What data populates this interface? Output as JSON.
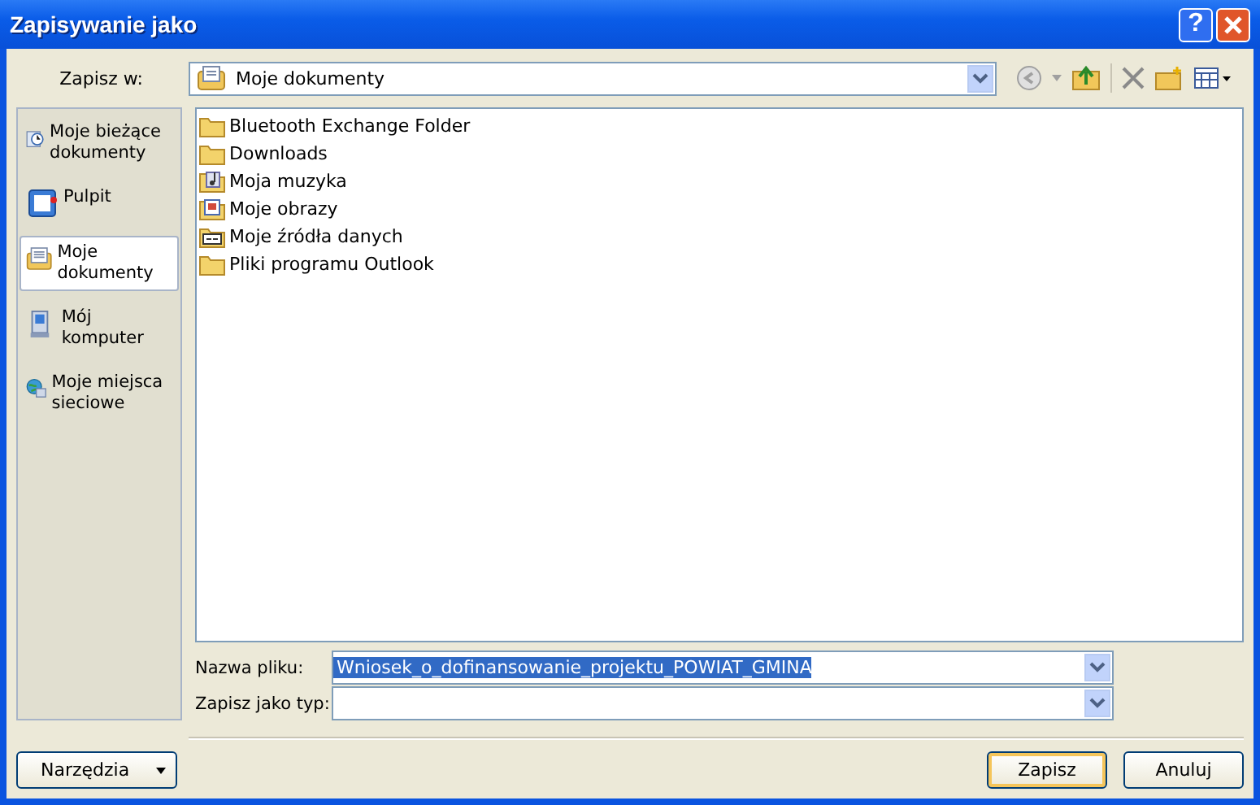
{
  "window": {
    "title": "Zapisywanie jako",
    "help_glyph": "?"
  },
  "location": {
    "label": "Zapisz w:",
    "value": "Moje dokumenty"
  },
  "sidebar": {
    "items": [
      {
        "label": "Moje bieżące dokumenty",
        "kind": "recent",
        "selected": false
      },
      {
        "label": "Pulpit",
        "kind": "desktop",
        "selected": false
      },
      {
        "label": "Moje dokumenty",
        "kind": "documents",
        "selected": true
      },
      {
        "label": "Mój komputer",
        "kind": "computer",
        "selected": false
      },
      {
        "label": "Moje miejsca sieciowe",
        "kind": "network",
        "selected": false
      }
    ]
  },
  "files": [
    {
      "name": "Bluetooth Exchange Folder",
      "kind": "folder"
    },
    {
      "name": "Downloads",
      "kind": "folder"
    },
    {
      "name": "Moja muzyka",
      "kind": "music"
    },
    {
      "name": "Moje obrazy",
      "kind": "pictures"
    },
    {
      "name": "Moje źródła danych",
      "kind": "data"
    },
    {
      "name": "Pliki programu Outlook",
      "kind": "folder"
    }
  ],
  "filename": {
    "label": "Nazwa pliku:",
    "value": "Wniosek_o_dofinansowanie_projektu_POWIAT_GMINA",
    "text_selected": true
  },
  "filetype": {
    "label": "Zapisz jako typ:"
  },
  "buttons": {
    "tools": "Narzędzia",
    "save": "Zapisz",
    "cancel": "Anuluj"
  }
}
